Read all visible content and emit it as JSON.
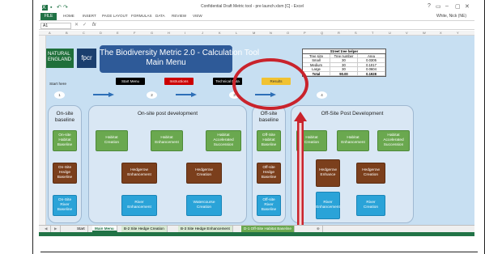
{
  "window": {
    "title": "Confidential Draft Metric tool - pre launch.xlsm [C] - Excel",
    "user": "White, Nick (NE)",
    "controls": [
      "?",
      "▭",
      "–",
      "▢",
      "✕"
    ]
  },
  "ribbon": {
    "file": "FILE",
    "tabs": [
      "HOME",
      "INSERT",
      "PAGE LAYOUT",
      "FORMULAS",
      "DATA",
      "REVIEW",
      "VIEW"
    ]
  },
  "formula_bar": {
    "name_box": "A1",
    "fx": "fx"
  },
  "columns": [
    "A",
    "B",
    "C",
    "D",
    "E",
    "F",
    "G",
    "H",
    "I",
    "J",
    "K",
    "L",
    "M",
    "N",
    "O",
    "P",
    "Q",
    "R",
    "S",
    "T",
    "U",
    "V",
    "W",
    "X",
    "Y"
  ],
  "logos": {
    "ne": "NATURAL ENGLAND",
    "fpcr": "fpcr"
  },
  "banner": {
    "line1": "The Biodiversity Metric 2.0 - Calculation Tool",
    "line2": "Main Menu"
  },
  "nav_buttons": [
    {
      "label": "Start Menu",
      "bg": "#000000",
      "fg": "#ffffff"
    },
    {
      "label": "Instructions",
      "bg": "#cc0000",
      "fg": "#ffffff"
    },
    {
      "label": "Technical Data",
      "bg": "#000000",
      "fg": "#ffffff"
    },
    {
      "label": "Results",
      "bg": "#f1c232",
      "fg": "#333333"
    }
  ],
  "street_tree": {
    "title": "Street tree helper",
    "headers": [
      "Tree size",
      "Tree number",
      "Area"
    ],
    "rows": [
      [
        "Small",
        "30",
        "0.0305"
      ],
      [
        "Medium",
        "30",
        "0.1017"
      ],
      [
        "Large",
        "30",
        "0.0604"
      ]
    ],
    "total": [
      "Total",
      "90.00",
      "0.1928"
    ]
  },
  "start_here": "Start here",
  "steps": [
    "1",
    "2",
    "3",
    "4"
  ],
  "panels": {
    "onsite_baseline": "On-site baseline",
    "onsite_post": "On-site post development",
    "offsite_baseline": "Off-site baseline",
    "offsite_post": "Off-Site Post Development"
  },
  "boxes": {
    "onsite_habitat_baseline": "On-site Habitat Baseline",
    "onsite_hedge_baseline": "On-Site Hedge Baseline",
    "onsite_river_baseline": "On-Site River Baseline",
    "habitat_creation": "Habitat Creation",
    "habitat_enhancement": "Habitat Enhancement",
    "habitat_accel": "Habitat Accelerated Succession",
    "hedgerow_enhancement": "Hedgerow Enhancement",
    "hedgerow_creation": "Hedgerow Creation",
    "river_enhancement": "River Enhancement",
    "watercourse_creation": "Watercourse Creation",
    "offsite_habitat_baseline": "Off-Site Habitat Baseline",
    "offsite_hedge_baseline": "Off-site Hedge Baseline",
    "offsite_river_baseline": "Off-site River Baseline",
    "off_habitat_creation": "Habitat Creation",
    "off_habitat_enhancement": "Habitat Enhancement",
    "off_habitat_accel": "Habitat Accelerated Succession",
    "off_hedgerow_enhance": "Hedgerow Enhance",
    "off_hedgerow_creation": "Hedgerow Creation",
    "off_river_enhancement": "River Enhancement",
    "off_river_creation": "River Creation"
  },
  "sheet_tabs": [
    "Start",
    "Main Menu",
    "B-2 Site Hedge Creation",
    "B-3 Site Hedge Enhancement",
    "D-1 Off-Site Habitat Baseline"
  ],
  "colors": {
    "excel_green": "#217346",
    "annotation_red": "#c9232c",
    "sheet_bg": "#c7dff2"
  }
}
